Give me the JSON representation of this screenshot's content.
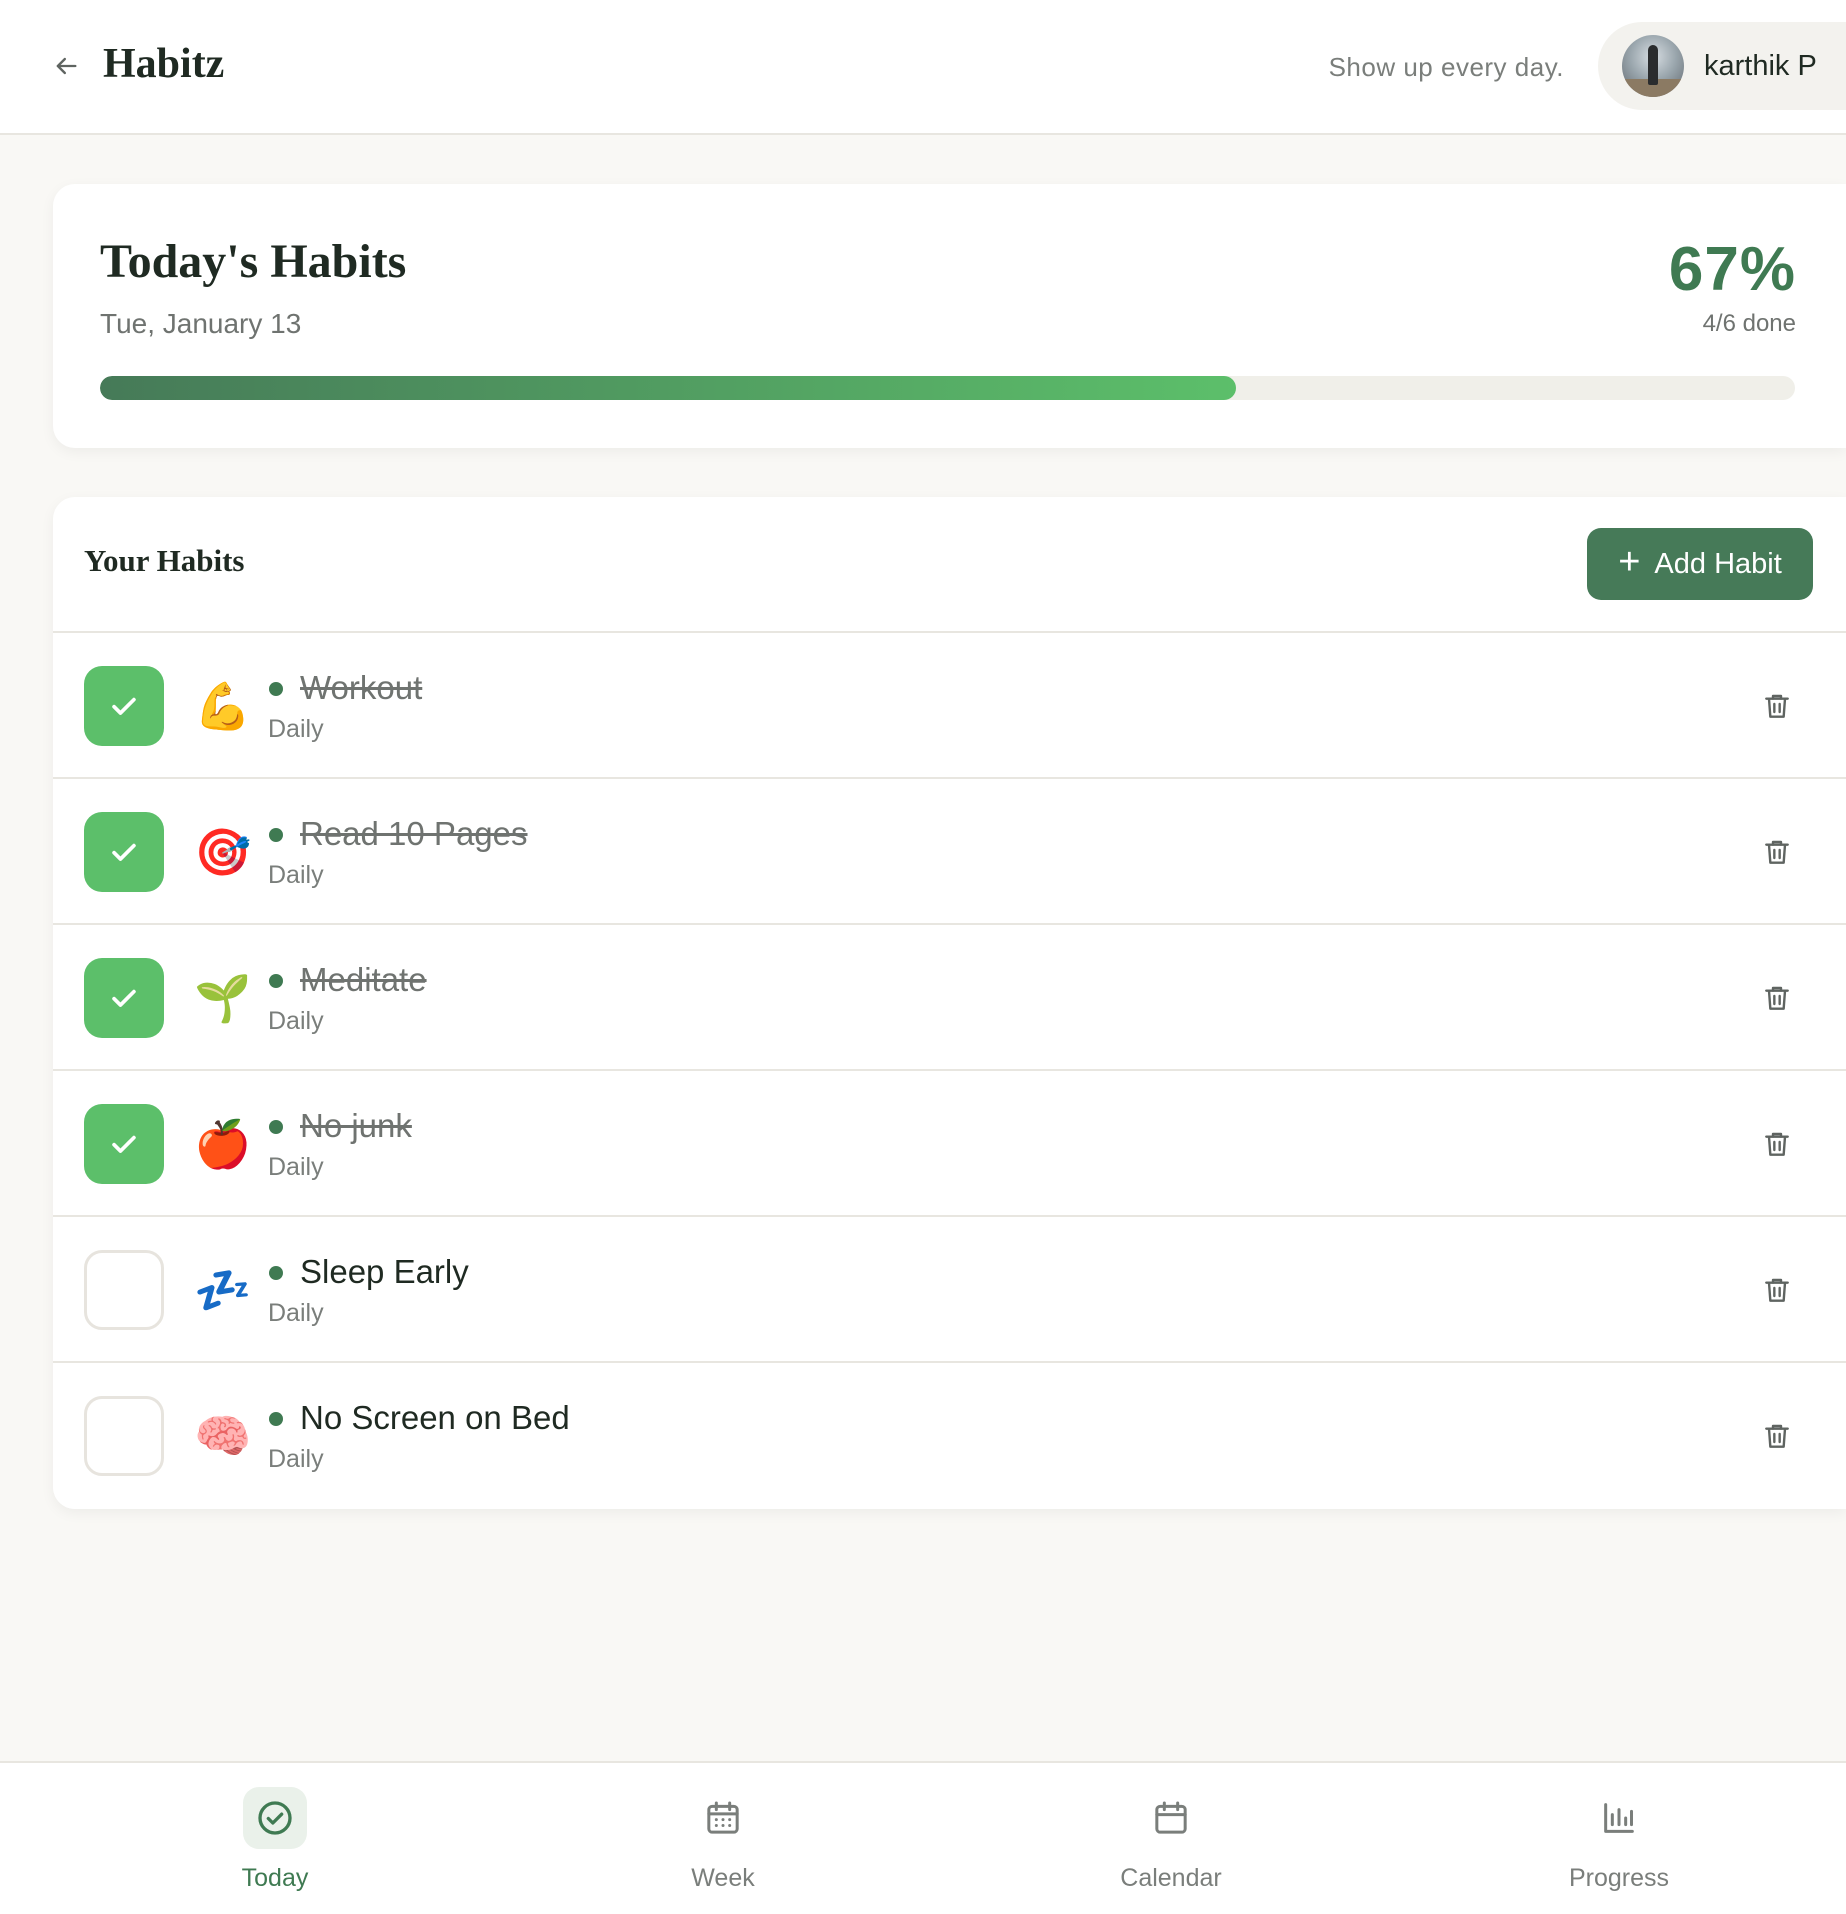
{
  "header": {
    "title": "Habitz",
    "tagline": "Show up every day.",
    "user_name": "karthik P"
  },
  "summary": {
    "title": "Today's Habits",
    "date": "Tue, January 13",
    "percent_label": "67%",
    "done_label": "4/6 done",
    "progress_fraction": 0.67
  },
  "habits_section": {
    "heading": "Your Habits",
    "add_button_label": "Add Habit",
    "items": [
      {
        "name": "Workout",
        "frequency": "Daily",
        "emoji": "💪",
        "done": true
      },
      {
        "name": "Read 10 Pages",
        "frequency": "Daily",
        "emoji": "🎯",
        "done": true
      },
      {
        "name": "Meditate",
        "frequency": "Daily",
        "emoji": "🌱",
        "done": true
      },
      {
        "name": "No junk",
        "frequency": "Daily",
        "emoji": "🍎",
        "done": true
      },
      {
        "name": "Sleep Early",
        "frequency": "Daily",
        "emoji": "💤",
        "done": false
      },
      {
        "name": "No Screen on Bed",
        "frequency": "Daily",
        "emoji": "🧠",
        "done": false
      }
    ]
  },
  "bottom_nav": {
    "items": [
      {
        "label": "Today",
        "icon": "check-circle-icon",
        "active": true
      },
      {
        "label": "Week",
        "icon": "calendar-grid-icon",
        "active": false
      },
      {
        "label": "Calendar",
        "icon": "calendar-icon",
        "active": false
      },
      {
        "label": "Progress",
        "icon": "bar-chart-icon",
        "active": false
      }
    ]
  },
  "colors": {
    "accent": "#467a58",
    "accent_text": "#3f7a52",
    "check_done": "#5cbf6a",
    "background": "#f9f8f5"
  }
}
